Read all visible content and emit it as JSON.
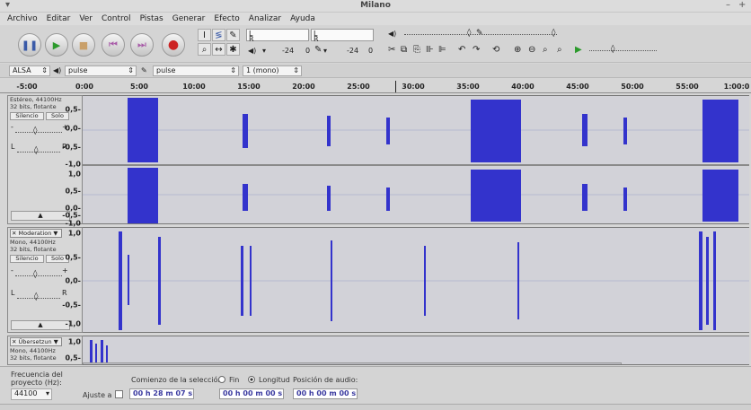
{
  "window": {
    "title": "Milano",
    "menu_icon": "▾",
    "minimize": "–",
    "maximize": "+"
  },
  "menu": [
    "Archivo",
    "Editar",
    "Ver",
    "Control",
    "Pistas",
    "Generar",
    "Efecto",
    "Analizar",
    "Ayuda"
  ],
  "meters": {
    "rec_L": "L",
    "rec_R": "R",
    "play_L": "L",
    "play_R": "R",
    "db1": "-24",
    "db2": "0",
    "db3": "-24",
    "db4": "0"
  },
  "device": {
    "host": "ALSA",
    "output": "pulse",
    "input": "pulse",
    "channels": "1 (mono)"
  },
  "ruler": [
    "-5:00",
    "0:00",
    "5:00",
    "10:00",
    "15:00",
    "20:00",
    "25:00",
    "30:00",
    "35:00",
    "40:00",
    "45:00",
    "50:00",
    "55:00",
    "1:00:0"
  ],
  "tracks": [
    {
      "info": [
        "Estéreo, 44100Hz",
        "32 bits, flotante"
      ],
      "mute": "Silencio",
      "solo": "Solo",
      "axis1": [
        "0,5-",
        "0,0-",
        "-0,5-",
        "-1,0"
      ],
      "axis2": [
        "1,0",
        "0,5-",
        "0,0-",
        "-0,5-",
        "-1,0"
      ],
      "gain_minus": "-",
      "gain_plus": "+",
      "pan_L": "L",
      "pan_R": "R"
    },
    {
      "name": "Moderation",
      "info": [
        "Mono, 44100Hz",
        "32 bits, flotante"
      ],
      "mute": "Silencio",
      "solo": "Solo",
      "axis": [
        "1,0",
        "0,5-",
        "0,0-",
        "-0,5-",
        "-1,0"
      ],
      "gain_minus": "-",
      "gain_plus": "+",
      "pan_L": "L",
      "pan_R": "R"
    },
    {
      "name": "Übersetzun",
      "info": [
        "Mono, 44100Hz",
        "32 bits, flotante"
      ],
      "axis": [
        "1,0",
        "0,5-"
      ]
    }
  ],
  "selection": {
    "rate_label": "Frecuencia del proyecto (Hz):",
    "rate_value": "44100",
    "snap_label": "Ajuste a",
    "start_label": "Comienzo de la selección:",
    "end_label": "Fin",
    "length_label": "Longitud",
    "position_label": "Posición de audio:",
    "start_value": "00 h 28 m 07 s",
    "length_value": "00 h 00 m 00 s",
    "position_value": "00 h 00 m 00 s"
  },
  "colors": {
    "wave": "#3333cc",
    "wave_bg": "#ffffff",
    "track_bg": "#d2d2d8"
  }
}
